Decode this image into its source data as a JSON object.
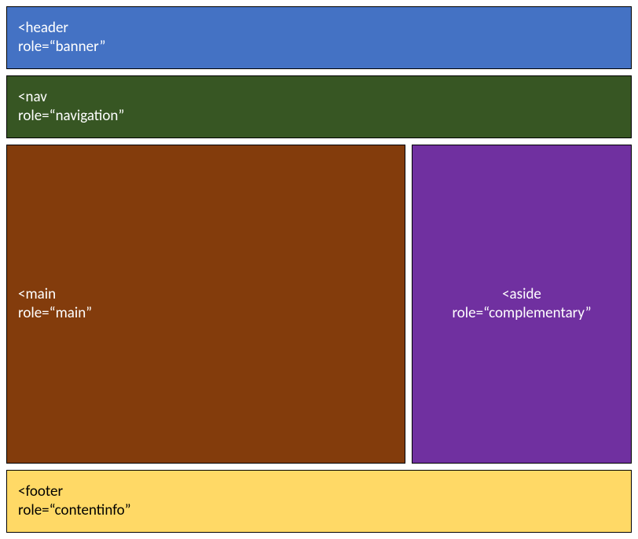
{
  "regions": {
    "header": {
      "tag_line": "<header",
      "role_line": "role=“banner”"
    },
    "nav": {
      "tag_line": "<nav",
      "role_line": "role=“navigation”"
    },
    "main": {
      "tag_line": "<main",
      "role_line": "role=“main”"
    },
    "aside": {
      "tag_line": "<aside",
      "role_line": "role=“complementary”"
    },
    "footer": {
      "tag_line": "<footer",
      "role_line": "role=“contentinfo”"
    }
  }
}
